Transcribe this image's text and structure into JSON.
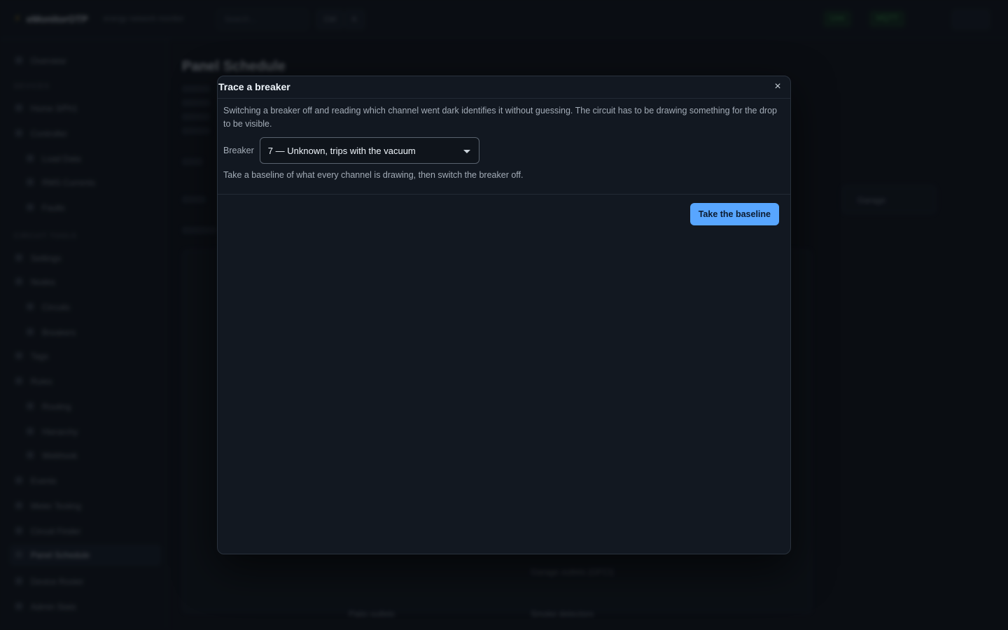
{
  "background": {
    "brand": {
      "name": "eMonitorOTP",
      "tagline": "energy network monitor"
    },
    "topbar": {
      "search_placeholder": "Search…",
      "chip_a": "Ctrl",
      "chip_b": "K",
      "status_live": "Live",
      "status_mqtt": "MQTT"
    },
    "sidebar": {
      "items": [
        "Overview",
        "Home 3/Ph1",
        "Controller",
        "Load Data",
        "RMS Currents",
        "Faults",
        "Settings",
        "Nodes",
        "Circuits",
        "Breakers",
        "Tags",
        "Rules",
        "Routing",
        "Hierarchy",
        "Webhook",
        "Events",
        "Meter Testing",
        "Circuit Finder",
        "Panel Schedule",
        "Device Roster",
        "Admin Stats"
      ],
      "sections": [
        "DEVICES",
        "CIRCUIT TOOLS"
      ]
    },
    "main": {
      "title": "Panel Schedule",
      "filter_value": "Garage",
      "rows": [
        "Garage outlets (GFCI)",
        "Smoke detectors",
        "Patio outlets"
      ]
    }
  },
  "modal": {
    "title": "Trace a breaker",
    "close_label": "×",
    "description": "Switching a breaker off and reading which channel went dark identifies it without guessing. The circuit has to be drawing something for the drop to be visible.",
    "breaker_label": "Breaker",
    "breaker_value": "7 — Unknown, trips with the vacuum",
    "hint": "Take a baseline of what every channel is drawing, then switch the breaker off.",
    "primary_action": "Take the baseline"
  },
  "colors": {
    "accent": "#58a6ff",
    "surface": "#121821",
    "page": "#0d1117"
  }
}
